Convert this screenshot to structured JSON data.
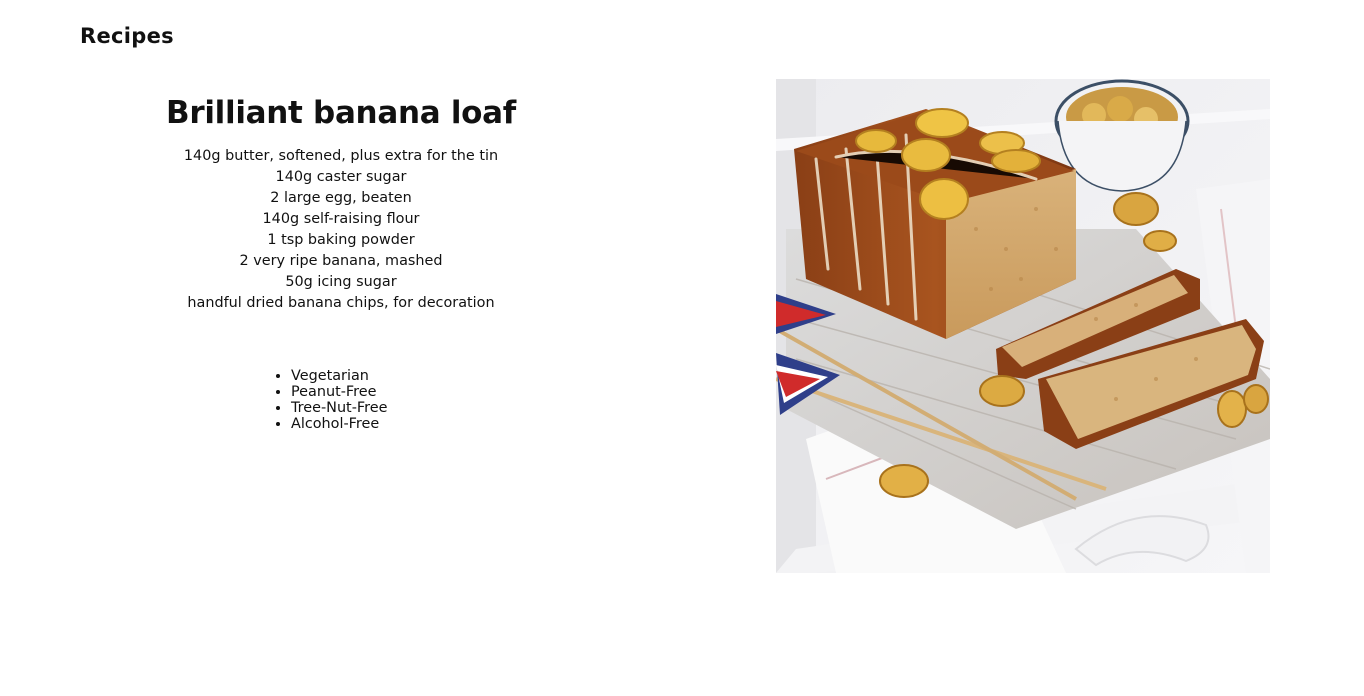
{
  "header": {
    "brand": "Recipes"
  },
  "recipe": {
    "title": "Brilliant banana loaf",
    "ingredients": [
      "140g butter, softened, plus extra for the tin",
      "140g caster sugar",
      "2 large egg, beaten",
      "140g self-raising flour",
      "1 tsp baking powder",
      "2 very ripe banana, mashed",
      "50g icing sugar",
      "handful dried banana chips, for decoration"
    ],
    "dietary_tags": [
      "Vegetarian",
      "Peanut-Free",
      "Tree-Nut-Free",
      "Alcohol-Free"
    ]
  },
  "colors": {
    "text": "#111111",
    "background": "#ffffff"
  }
}
